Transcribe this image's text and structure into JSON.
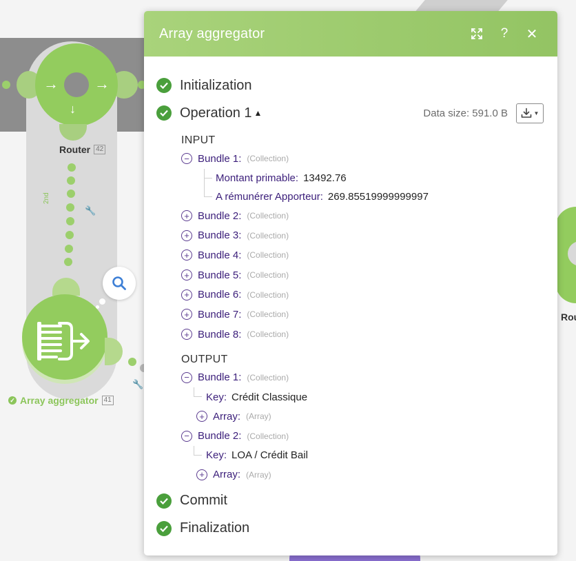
{
  "canvas": {
    "router": {
      "label": "Router",
      "id": "42"
    },
    "aggregator": {
      "label": "Array aggregator",
      "id": "41"
    },
    "filter_label": "2nd",
    "right_node_label": "Rou"
  },
  "panel": {
    "title": "Array aggregator",
    "stages": {
      "initialization": "Initialization",
      "operation": "Operation 1",
      "commit": "Commit",
      "finalization": "Finalization"
    },
    "data_size": "Data size: 591.0 B",
    "input": {
      "title": "INPUT",
      "bundles": [
        {
          "label": "Bundle 1:",
          "type": "(Collection)",
          "expanded": true,
          "fields": [
            {
              "key": "Montant primable:",
              "value": "13492.76"
            },
            {
              "key": "A rémunérer Apporteur:",
              "value": "269.85519999999997"
            }
          ]
        },
        {
          "label": "Bundle 2:",
          "type": "(Collection)"
        },
        {
          "label": "Bundle 3:",
          "type": "(Collection)"
        },
        {
          "label": "Bundle 4:",
          "type": "(Collection)"
        },
        {
          "label": "Bundle 5:",
          "type": "(Collection)"
        },
        {
          "label": "Bundle 6:",
          "type": "(Collection)"
        },
        {
          "label": "Bundle 7:",
          "type": "(Collection)"
        },
        {
          "label": "Bundle 8:",
          "type": "(Collection)"
        }
      ]
    },
    "output": {
      "title": "OUTPUT",
      "bundles": [
        {
          "label": "Bundle 1:",
          "type": "(Collection)",
          "key_label": "Key:",
          "key_value": "Crédit Classique",
          "array_label": "Array:",
          "array_type": "(Array)"
        },
        {
          "label": "Bundle 2:",
          "type": "(Collection)",
          "key_label": "Key:",
          "key_value": "LOA / Crédit Bail",
          "array_label": "Array:",
          "array_type": "(Array)"
        }
      ]
    }
  },
  "colors": {
    "header_green": "#a9d37b",
    "node_green": "#93cc5e",
    "check_green": "#4a9f3c",
    "key_purple": "#3b1e7a"
  },
  "icons": {
    "header": [
      "expand-icon",
      "help-icon",
      "close-icon"
    ],
    "stage": "check-circle-icon",
    "toggle_expand": "plus-circle-icon",
    "toggle_collapse": "minus-circle-icon"
  }
}
